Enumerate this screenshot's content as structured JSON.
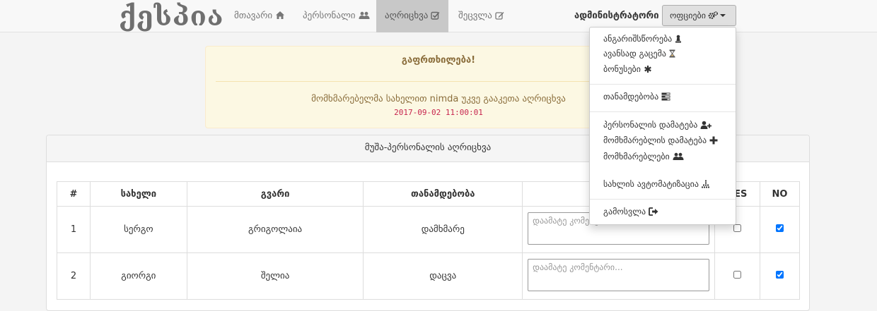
{
  "brand": "ქესპია",
  "nav": {
    "items": [
      {
        "label": "მთავარი",
        "icon": "home-icon"
      },
      {
        "label": "პერსონალი",
        "icon": "users-icon"
      },
      {
        "label": "აღრიცხვა",
        "icon": "check-square-icon",
        "active": true
      },
      {
        "label": "შეცვლა",
        "icon": "edit-icon"
      }
    ],
    "admin_label": "ადმინისტრატორი",
    "office_label": "ოფციები",
    "office_icon": "cogs-icon"
  },
  "alert": {
    "title": "გაფრთხილება!",
    "message_prefix": "მომხმარებელმა სახელით ",
    "username": "nimda",
    "message_suffix": " უკვე გააკეთა აღრიცხვა",
    "timestamp": "2017-09-02 11:00:01"
  },
  "panel": {
    "title": "მუშა-პერსონალის აღრიცხვა"
  },
  "table": {
    "headers": [
      "#",
      "სახელი",
      "გვარი",
      "თანამდებობა",
      "",
      "YES",
      "NO"
    ],
    "comment_placeholder": "დაამატე კომენტარი...",
    "rows": [
      {
        "num": "1",
        "first_name": "სერგო",
        "last_name": "გრიგოლაია",
        "position": "დამხმარე",
        "yes": false,
        "no": true
      },
      {
        "num": "2",
        "first_name": "გიორგი",
        "last_name": "შელია",
        "position": "დაცვა",
        "yes": false,
        "no": true
      }
    ]
  },
  "dropdown": {
    "items": [
      {
        "label": "ანგარიშსწორება",
        "icon": "chess-pawn-icon"
      },
      {
        "label": "ავანსად გაცემა",
        "icon": "hourglass-icon"
      },
      {
        "label": "ბონუსები",
        "icon": "asterisk-icon"
      },
      {
        "label": "თანამდებობა",
        "icon": "tasks-icon"
      },
      {
        "label": "პერსონალის დამატება",
        "icon": "user-plus-icon"
      },
      {
        "label": "მომხმარებლის დამატება",
        "icon": "plus-icon"
      },
      {
        "label": "მომხმარებლები",
        "icon": "users-icon"
      },
      {
        "label": "სახლის ავტომატიზაცია",
        "icon": "grid-icon"
      },
      {
        "label": "გამოსვლა",
        "icon": "sign-out-icon"
      }
    ]
  },
  "colors": {
    "alert_bg": "#fcf8e3",
    "alert_text": "#8a6d3b",
    "timestamp": "#c7254e",
    "active_nav": "#c8c8c8"
  }
}
